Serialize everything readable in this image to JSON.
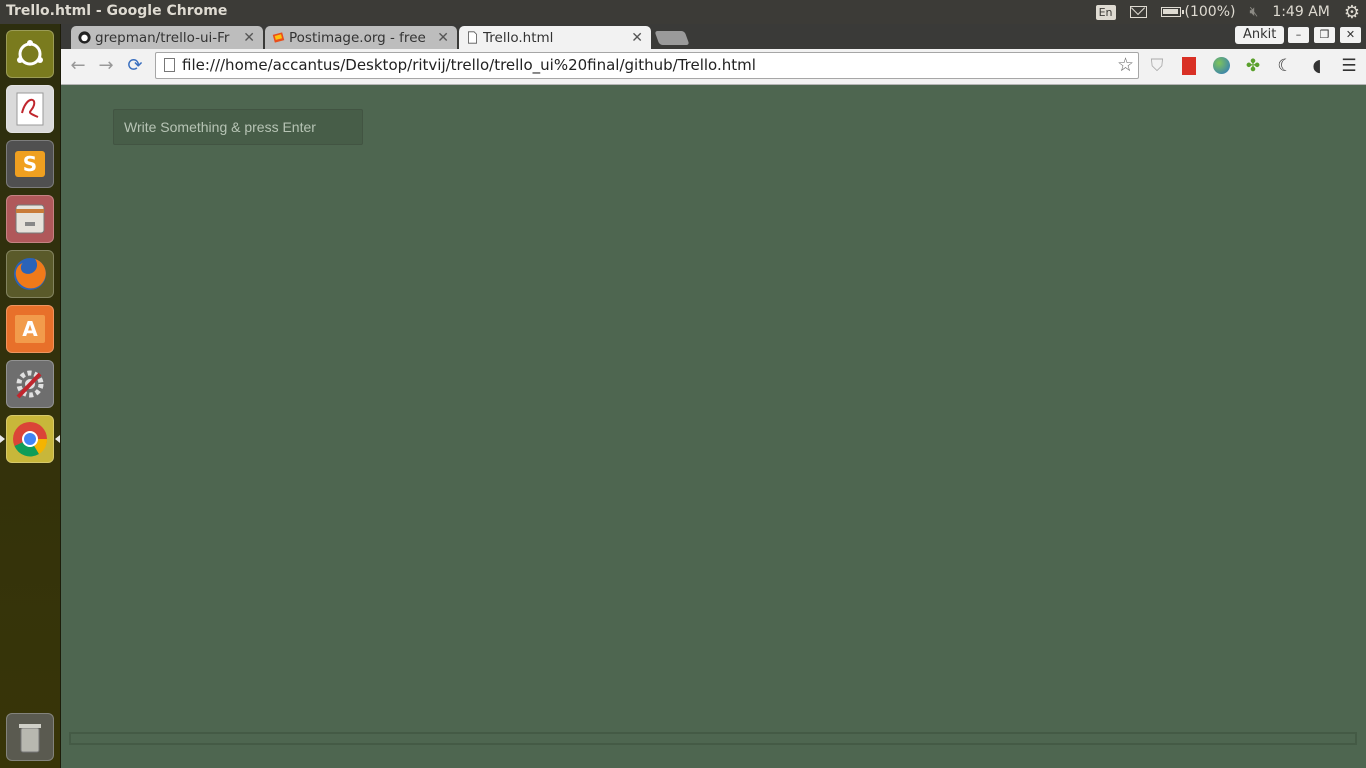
{
  "top_panel": {
    "window_title": "Trello.html - Google Chrome",
    "language": "En",
    "battery": "(100%)",
    "time": "1:49 AM",
    "icons": [
      "mail-icon",
      "battery-icon",
      "volume-muted-icon",
      "settings-gear-icon"
    ]
  },
  "launcher": {
    "items": [
      {
        "name": "ubuntu-dash",
        "icon": "ubuntu-logo-icon",
        "color": "#7a7b1e"
      },
      {
        "name": "document-viewer",
        "icon": "pdf-viewer-icon",
        "color": "#dadada"
      },
      {
        "name": "sublime-text",
        "icon": "sublime-icon",
        "color": "#505050"
      },
      {
        "name": "files",
        "icon": "file-cabinet-icon",
        "color": "#b0585a"
      },
      {
        "name": "firefox",
        "icon": "firefox-icon",
        "color": "#e06a1e"
      },
      {
        "name": "software-center",
        "icon": "software-center-icon",
        "color": "#e8702a"
      },
      {
        "name": "system-settings",
        "icon": "settings-tools-icon",
        "color": "#6e6e6e"
      },
      {
        "name": "chrome",
        "icon": "chrome-icon",
        "color": "#c8b73a"
      },
      {
        "name": "trash",
        "icon": "trash-icon",
        "color": "#5a5a50"
      }
    ],
    "labels": {
      "sublime": "S",
      "software_center": "A"
    }
  },
  "chrome": {
    "tabs": [
      {
        "title": "grepman/trello-ui-Fr",
        "icon": "github-icon",
        "active": false
      },
      {
        "title": "Postimage.org - free",
        "icon": "postimage-icon",
        "active": false
      },
      {
        "title": "Trello.html",
        "icon": "page-icon",
        "active": true
      }
    ],
    "user": "Ankit",
    "window_buttons": {
      "minimize": "–",
      "restore": "❐",
      "close": "✕"
    },
    "nav": {
      "back": "←",
      "forward": "→",
      "reload": "⟳"
    },
    "url": "file:///home/accantus/Desktop/ritvij/trello/trello_ui%20final/github/Trello.html",
    "extensions": [
      "shield-icon",
      "bookmark-red-icon",
      "globe-icon",
      "leaf-icon",
      "moon-icon",
      "audio-icon",
      "menu-icon"
    ]
  },
  "page": {
    "background": "#4e6650",
    "card_input": {
      "placeholder": "Write Something & press Enter",
      "value": ""
    }
  }
}
